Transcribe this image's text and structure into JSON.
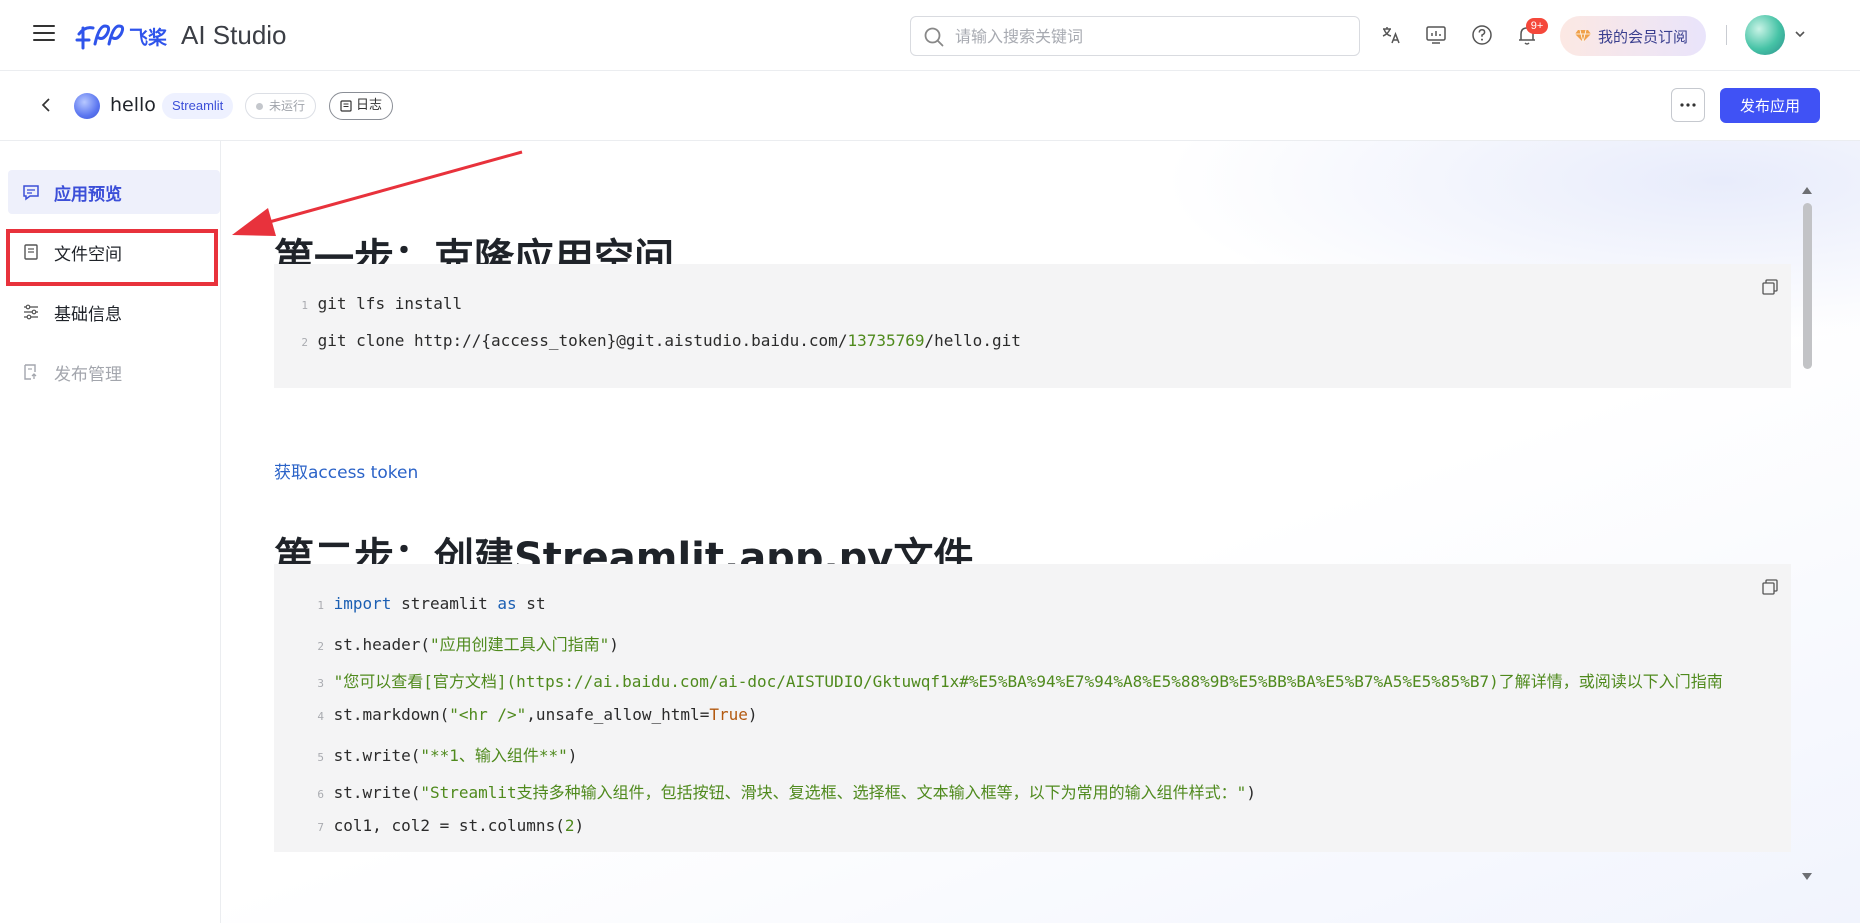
{
  "topbar": {
    "brand_cn": "飞桨",
    "brand_en": "AI Studio",
    "search_placeholder": "请输入搜索关键词",
    "notification_badge": "9+",
    "member_label": "我的会员订阅",
    "icons": [
      "translate-icon",
      "monitor-icon",
      "help-icon",
      "bell-icon"
    ]
  },
  "subbar": {
    "app_name": "hello",
    "framework_tag": "Streamlit",
    "status": "未运行",
    "log_label": "日志",
    "more_label": "···",
    "publish_label": "发布应用"
  },
  "sidebar": {
    "items": [
      {
        "label": "应用预览",
        "state": "active"
      },
      {
        "label": "文件空间",
        "state": "normal"
      },
      {
        "label": "基础信息",
        "state": "normal"
      },
      {
        "label": "发布管理",
        "state": "disabled"
      }
    ]
  },
  "main": {
    "step1_title": "第一步：克隆应用空间",
    "step1_code": [
      {
        "n": "1",
        "text": "git lfs install"
      },
      {
        "n": "2",
        "pre": "git clone http://{access_token}@git.aistudio.baidu.com/",
        "id": "13735769",
        "post": "/hello.git"
      }
    ],
    "token_link": "获取access token",
    "step2_title": "第二步：创建Streamlit.app.py文件",
    "step2_code": {
      "l1_kw1": "import",
      "l1_mid": " streamlit ",
      "l1_kw2": "as",
      "l1_end": " st",
      "l2_pre": "st.header(",
      "l2_str": "\"应用创建工具入门指南\"",
      "l2_post": ")",
      "l3_str": "\"您可以查看[官方文档](https://ai.baidu.com/ai-doc/AISTUDIO/Gktuwqf1x#%E5%BA%94%E7%94%A8%E5%88%9B%E5%BB%BA%E5%B7%A5%E5%85%B7)了解详情，或阅读以下入门指南",
      "l4_pre": "st.markdown(",
      "l4_str": "\"<hr />\"",
      "l4_mid": ",unsafe_allow_html=",
      "l4_lit": "True",
      "l4_post": ")",
      "l5_pre": "st.write(",
      "l5_str": "\"**1、输入组件**\"",
      "l5_post": ")",
      "l6_pre": "st.write(",
      "l6_str": "\"Streamlit支持多种输入组件，包括按钮、滑块、复选框、选择框、文本输入框等，以下为常用的输入组件样式：\"",
      "l6_post": ")",
      "l7_pre": "col1, col2 = st.columns(",
      "l7_num": "2",
      "l7_post": ")",
      "line_numbers": [
        "1",
        "2",
        "3",
        "4",
        "5",
        "6",
        "7"
      ]
    }
  },
  "colors": {
    "accent": "#4052f5",
    "active_bg": "#eef0fb",
    "highlight": "#e8323c",
    "code_bg": "#f4f4f5"
  }
}
